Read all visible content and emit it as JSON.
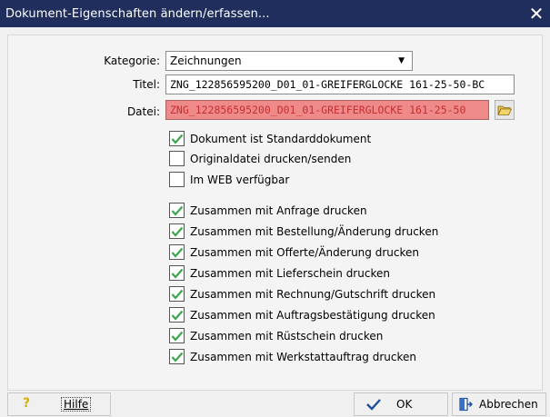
{
  "window": {
    "title": "Dokument-Eigenschaften ändern/erfassen...",
    "close_glyph": "✕"
  },
  "form": {
    "kategorie_label": "Kategorie:",
    "kategorie_value": "Zeichnungen",
    "titel_label": "Titel:",
    "titel_value": "ZNG_122856595200_D01_01-GREIFERGLOCKE 161-25-50-BC",
    "datei_label": "Datei:",
    "datei_value": "ZNG_122856595200_D01_01-GREIFERGLOCKE 161-25-50",
    "browse_icon": "folder-open-icon"
  },
  "options": [
    {
      "label": "Dokument ist Standarddokument",
      "checked": true
    },
    {
      "label": "Originaldatei drucken/senden",
      "checked": false
    },
    {
      "label": "Im WEB verfügbar",
      "checked": false
    },
    {
      "label": "Zusammen mit Anfrage drucken",
      "checked": true
    },
    {
      "label": "Zusammen mit Bestellung/Änderung drucken",
      "checked": true
    },
    {
      "label": "Zusammen mit Offerte/Änderung drucken",
      "checked": true
    },
    {
      "label": "Zusammen mit Lieferschein drucken",
      "checked": true
    },
    {
      "label": "Zusammen mit Rechnung/Gutschrift drucken",
      "checked": true
    },
    {
      "label": "Zusammen mit Auftragsbestätigung drucken",
      "checked": true
    },
    {
      "label": "Zusammen mit Rüstschein drucken",
      "checked": true
    },
    {
      "label": "Zusammen mit Werkstattauftrag drucken",
      "checked": true
    }
  ],
  "footer": {
    "help_glyph": "?",
    "help_label": "Hilfe",
    "ok_label": "OK",
    "cancel_label": "Abbrechen"
  },
  "colors": {
    "titlebar": "#1f2e5c",
    "check_green": "#3aa54a",
    "file_bg": "#ee8a8a",
    "file_text": "#c53030",
    "ok_check": "#1d4e9e"
  }
}
